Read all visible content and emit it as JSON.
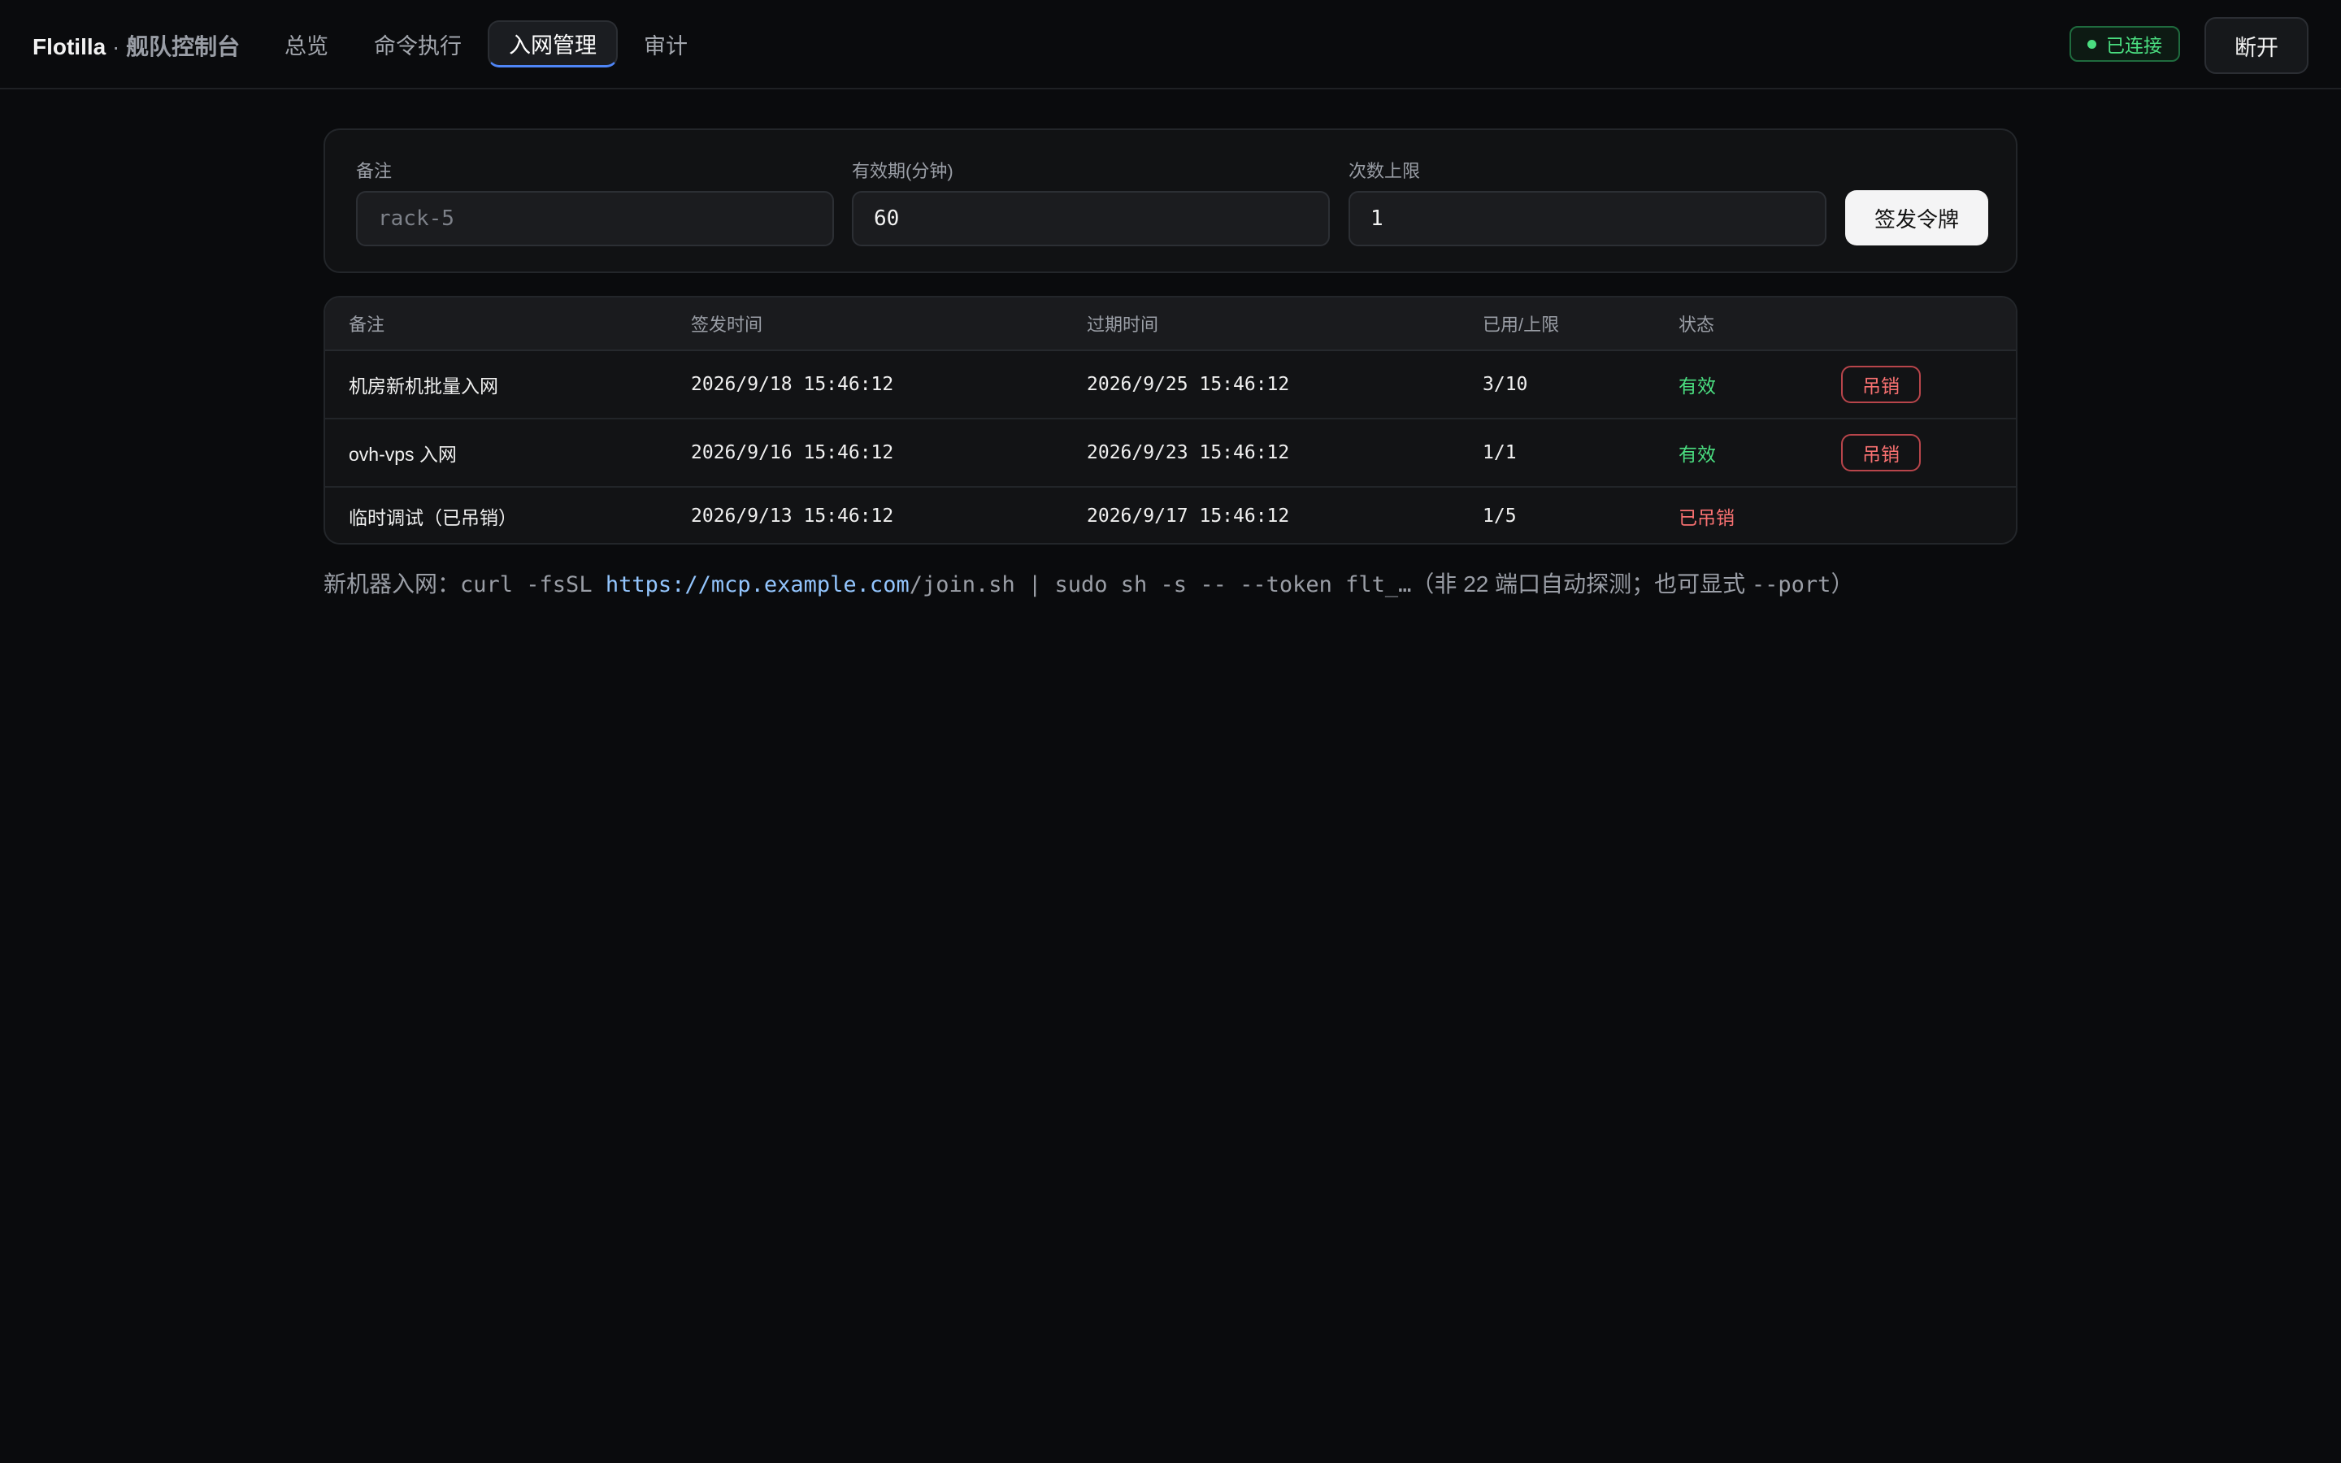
{
  "header": {
    "brand": "Flotilla",
    "separator": " · ",
    "subtitle": "舰队控制台",
    "tabs": [
      {
        "label": "总览",
        "active": false
      },
      {
        "label": "命令执行",
        "active": false
      },
      {
        "label": "入网管理",
        "active": true
      },
      {
        "label": "审计",
        "active": false
      }
    ],
    "connection_status": "已连接",
    "disconnect_label": "断开"
  },
  "issue_form": {
    "note_label": "备注",
    "note_placeholder": "rack-5",
    "ttl_label": "有效期(分钟)",
    "ttl_value": "60",
    "max_uses_label": "次数上限",
    "max_uses_value": "1",
    "submit_label": "签发令牌"
  },
  "tokens_table": {
    "columns": [
      "备注",
      "签发时间",
      "过期时间",
      "已用/上限",
      "状态"
    ],
    "rows": [
      {
        "note": "机房新机批量入网",
        "issued": "2026/9/18 15:46:12",
        "expires": "2026/9/25 15:46:12",
        "used": "3/10",
        "status": "有效",
        "action": "吊销"
      },
      {
        "note": "ovh-vps 入网",
        "issued": "2026/9/16 15:46:12",
        "expires": "2026/9/23 15:46:12",
        "used": "1/1",
        "status": "有效",
        "action": "吊销"
      },
      {
        "note": "临时调试（已吊销）",
        "issued": "2026/9/13 15:46:12",
        "expires": "2026/9/17 15:46:12",
        "used": "1/5",
        "status": "已吊销"
      }
    ]
  },
  "join_hint": {
    "prefix": "新机器入网：",
    "cmd_start": "curl -fsSL ",
    "link": "https://mcp.example.com",
    "cmd_end": "/join.sh | sudo sh -s -- --token flt_…",
    "note_open": "（非 22 端口自动探测；也可显式 ",
    "note_flag": "--port",
    "note_close": "）"
  },
  "colors": {
    "background": "#0a0b0d",
    "accent": "#4f86f7",
    "success": "#4ade80",
    "danger": "#f87171",
    "link": "#93c5fd"
  }
}
